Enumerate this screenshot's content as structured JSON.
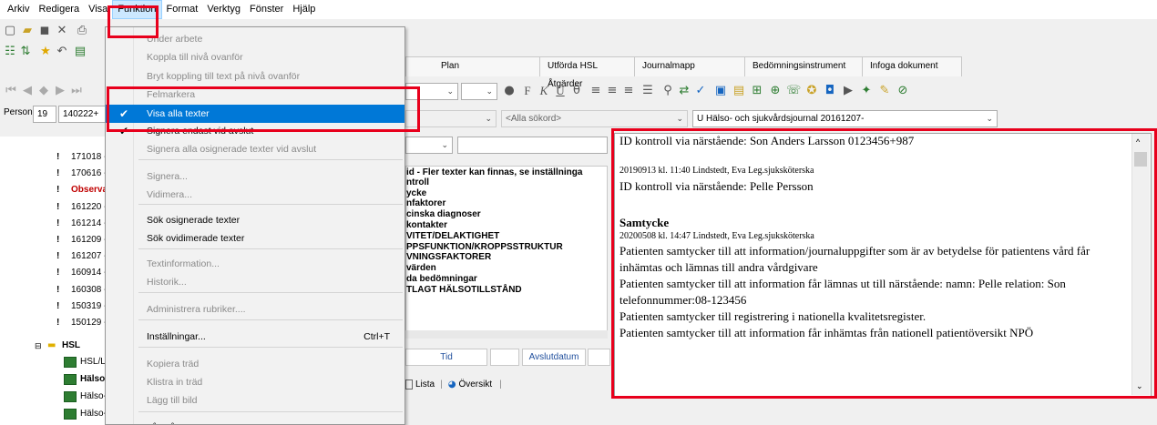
{
  "menubar": [
    "Arkiv",
    "Redigera",
    "Visa",
    "Funktion",
    "Format",
    "Verktyg",
    "Fönster",
    "Hjälp"
  ],
  "menu": {
    "items": [
      {
        "label": "Under arbete",
        "disabled": true
      },
      {
        "label": "Koppla till nivå ovanför",
        "disabled": true
      },
      {
        "label": "Bryt koppling till text på nivå ovanför",
        "disabled": true
      },
      {
        "label": "Felmarkera",
        "disabled": true
      },
      {
        "label": "Visa alla texter",
        "checked": true,
        "highlighted": true
      },
      {
        "label": "Signera endast vid avslut",
        "checked": true
      },
      {
        "label": "Signera alla osignerade texter vid avslut",
        "disabled": true
      },
      {
        "label": "Signera...",
        "disabled": true
      },
      {
        "label": "Vidimera...",
        "disabled": true
      },
      {
        "label": "Sök osignerade texter"
      },
      {
        "label": "Sök ovidimerade texter"
      },
      {
        "label": "Textinformation...",
        "disabled": true
      },
      {
        "label": "Historik...",
        "disabled": true
      },
      {
        "label": "Administrera rubriker....",
        "disabled": true
      },
      {
        "label": "Inställningar...",
        "shortcut": "Ctrl+T"
      },
      {
        "label": "Kopiera träd",
        "disabled": true
      },
      {
        "label": "Klistra in träd",
        "disabled": true
      },
      {
        "label": "Lägg till bild",
        "disabled": true
      },
      {
        "label": "Låt stå"
      }
    ]
  },
  "tabs": [
    "Plan",
    "Utförda HSL Åtgärder",
    "Journalmapp",
    "Bedömningsinstrument",
    "Infoga dokument"
  ],
  "person": {
    "label": "Person",
    "num": "19",
    "id": "140222+"
  },
  "search": {
    "all_keyword": "<Alla sökord>",
    "journal": "U Hälso- och sjukvårdsjournal 20161207-"
  },
  "tree": {
    "rows": [
      "171018 -",
      "170616 -",
      "Observat",
      "161220 -",
      "161214 -",
      "161209 -",
      "161207 -",
      "160914 -",
      "160308 -",
      "150319 -",
      "150129 -"
    ],
    "hsl_label": "HSL",
    "hsl_children": [
      "HSL/LSS",
      "Hälso- o",
      "Hälso- och",
      "Hälso- och"
    ]
  },
  "listbox": {
    "header": "id - Fler texter kan finnas, se inställninga",
    "items": [
      "ntroll",
      "ycke",
      "nfaktorer",
      "cinska diagnoser",
      "kontakter",
      "VITET/DELAKTIGHET",
      "PPSFUNKTION/KROPPSSTRUKTUR",
      "VNINGSFAKTORER",
      "värden",
      "da bedömningar",
      "TLAGT HÄLSOTILLSTÅND"
    ]
  },
  "fields": {
    "tid": "Tid",
    "avslutdatum": "Avslutdatum",
    "lista": "Lista",
    "oversikt": "Översikt"
  },
  "journal": {
    "lines": [
      {
        "type": "normal",
        "text": "ID kontroll via närstående: Son Anders Larsson 0123456+987"
      },
      {
        "type": "small",
        "text": "20190913 kl. 11:40  Lindstedt, Eva  Leg.sjuksköterska"
      },
      {
        "type": "normal",
        "text": "ID kontroll via närstående: Pelle Persson"
      },
      {
        "type": "heading",
        "text": "Samtycke"
      },
      {
        "type": "small",
        "text": "20200508 kl. 14:47  Lindstedt, Eva  Leg.sjuksköterska"
      },
      {
        "type": "normal",
        "text": "Patienten samtycker till att information/journaluppgifter som är av betydelse för patientens vård får"
      },
      {
        "type": "normal",
        "text": "inhämtas och lämnas till andra vårdgivare"
      },
      {
        "type": "normal",
        "text": "Patienten samtycker till att information får lämnas ut till närstående: namn: Pelle relation: Son"
      },
      {
        "type": "normal",
        "text": "telefonnummer:08-123456"
      },
      {
        "type": "normal",
        "text": "Patienten samtycker till registrering i nationella kvalitetsregister."
      },
      {
        "type": "normal",
        "text": "Patienten samtycker till att information får inhämtas från nationell patientöversikt NPÖ"
      }
    ]
  },
  "colors": {
    "highlight": "#0078d7",
    "annotation": "#e8001c",
    "warning": "#c00000"
  }
}
